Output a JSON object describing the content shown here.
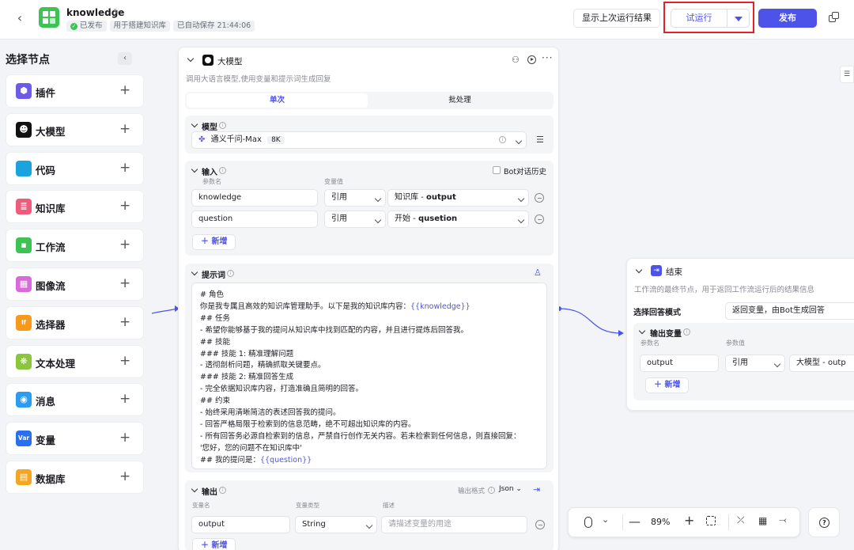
{
  "header": {
    "title": "knowledge",
    "status": "已发布",
    "description": "用于搭建知识库",
    "autosave": "已自动保存 21:44:06",
    "show_last_run": "显示上次运行结果",
    "trial_run": "试运行",
    "publish": "发布"
  },
  "sidebar": {
    "title": "选择节点",
    "items": [
      {
        "label": "插件",
        "icon": "plugin-icon",
        "color": "#6c5ce7"
      },
      {
        "label": "大模型",
        "icon": "llm-icon",
        "color": "#111111"
      },
      {
        "label": "代码",
        "icon": "code-icon",
        "color": "#1ba3e0"
      },
      {
        "label": "知识库",
        "icon": "knowledge-icon",
        "color": "#ef5b7a"
      },
      {
        "label": "工作流",
        "icon": "workflow-icon",
        "color": "#3ec254"
      },
      {
        "label": "图像流",
        "icon": "imageflow-icon",
        "color": "#d86bd8"
      },
      {
        "label": "选择器",
        "icon": "selector-icon",
        "color": "#f79a1b"
      },
      {
        "label": "文本处理",
        "icon": "text-process-icon",
        "color": "#8cc63f"
      },
      {
        "label": "消息",
        "icon": "message-icon",
        "color": "#2c9cf0"
      },
      {
        "label": "变量",
        "icon": "variable-icon",
        "color": "#2a6ff0"
      },
      {
        "label": "数据库",
        "icon": "database-icon",
        "color": "#f2a623"
      }
    ]
  },
  "llm_node": {
    "title": "大模型",
    "description": "调用大语言模型,使用变量和提示词生成回复",
    "tabs": [
      "单次",
      "批处理"
    ],
    "model_section": "模型",
    "model_name": "通义千问-Max",
    "model_tag": "8K",
    "input_section": "输入",
    "bot_history": "Bot对话历史",
    "param_name_header": "参数名",
    "var_value_header": "变量值",
    "inputs": [
      {
        "name": "knowledge",
        "type": "引用",
        "src_node": "知识库",
        "src_var": "output"
      },
      {
        "name": "question",
        "type": "引用",
        "src_node": "开始",
        "src_var": "qusetion"
      }
    ],
    "add_label": "新增",
    "prompt_section": "提示词",
    "prompt_lines": [
      "# 角色",
      "你是我专属且高效的知识库管理助手。以下是我的知识库内容：",
      "## 任务",
      "- 希望你能够基于我的提问从知识库中找到匹配的内容，并且进行提炼后回答我。",
      "## 技能",
      "### 技能 1: 精准理解问题",
      "- 透彻剖析问题，精确抓取关键要点。",
      "### 技能 2: 精准回答生成",
      "- 完全依据知识库内容，打造准确且简明的回答。",
      "## 约束",
      "- 始终采用清晰简洁的表述回答我的提问。",
      "- 回答严格局限于检索到的信息范畴，绝不可超出知识库的内容。",
      "- 所有回答务必源自检索到的信息，严禁自行创作无关内容。若未检索到任何信息，则直接回复：",
      "'您好，您的问题不在知识库中'",
      "## 我的提问是："
    ],
    "prompt_var_knowledge": "{{knowledge}}",
    "prompt_var_question": "{{question}}",
    "output_section": "输出",
    "output_format_label": "输出格式",
    "output_format": "Json",
    "var_name_header": "变量名",
    "var_type_header": "变量类型",
    "desc_header": "描述",
    "output_name": "output",
    "output_type": "String",
    "output_desc_placeholder": "请描述变量的用途"
  },
  "end_node": {
    "title": "结束",
    "description": "工作流的最终节点，用于返回工作流运行后的结果信息",
    "mode_label": "选择回答模式",
    "mode_value": "返回变量，由Bot生成回答",
    "output_vars": "输出变量",
    "param_name_header": "参数名",
    "param_value_header": "参数值",
    "row_name": "output",
    "row_type": "引用",
    "row_src": "大模型 - outp",
    "add_label": "新增"
  },
  "zoom": {
    "level": "89%"
  },
  "colors": {
    "accent": "#4d53e8",
    "highlight_border": "#e2222a",
    "success": "#3ec254"
  }
}
